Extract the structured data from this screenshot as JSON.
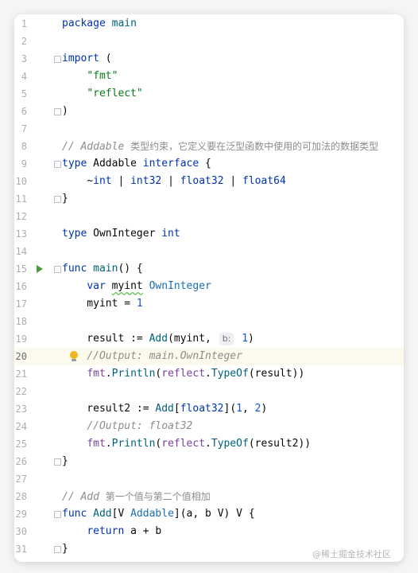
{
  "editor": {
    "run_line": 15,
    "highlighted_line": 20,
    "lines": [
      {
        "n": "1",
        "t": [
          [
            "kw",
            "package"
          ],
          [
            "t",
            " "
          ],
          [
            "fn",
            "main"
          ]
        ]
      },
      {
        "n": "2",
        "t": []
      },
      {
        "n": "3",
        "fold": true,
        "t": [
          [
            "kw",
            "import"
          ],
          [
            "t",
            " ("
          ]
        ]
      },
      {
        "n": "4",
        "t": [
          [
            "t",
            "    "
          ],
          [
            "str",
            "\"fmt\""
          ]
        ]
      },
      {
        "n": "5",
        "t": [
          [
            "t",
            "    "
          ],
          [
            "str",
            "\"reflect\""
          ]
        ]
      },
      {
        "n": "6",
        "fold": true,
        "t": [
          [
            "t",
            ")"
          ]
        ]
      },
      {
        "n": "7",
        "t": []
      },
      {
        "n": "8",
        "t": [
          [
            "cmt",
            "// Addable "
          ],
          [
            "cmt-cjk",
            "类型约束，它定义要在泛型函数中使用的可加法的数据类型"
          ]
        ]
      },
      {
        "n": "9",
        "fold": true,
        "t": [
          [
            "kw",
            "type"
          ],
          [
            "t",
            " Addable "
          ],
          [
            "kw",
            "interface"
          ],
          [
            "t",
            " {"
          ]
        ]
      },
      {
        "n": "10",
        "t": [
          [
            "t",
            "    ~"
          ],
          [
            "typename",
            "int"
          ],
          [
            "t",
            " | "
          ],
          [
            "typename",
            "int32"
          ],
          [
            "t",
            " | "
          ],
          [
            "typename",
            "float32"
          ],
          [
            "t",
            " | "
          ],
          [
            "typename",
            "float64"
          ]
        ]
      },
      {
        "n": "11",
        "fold": true,
        "t": [
          [
            "t",
            "}"
          ]
        ]
      },
      {
        "n": "12",
        "t": []
      },
      {
        "n": "13",
        "t": [
          [
            "kw",
            "type"
          ],
          [
            "t",
            " OwnInteger "
          ],
          [
            "typename",
            "int"
          ]
        ]
      },
      {
        "n": "14",
        "t": []
      },
      {
        "n": "15",
        "run": true,
        "fold": true,
        "t": [
          [
            "kw",
            "func"
          ],
          [
            "t",
            " "
          ],
          [
            "fn",
            "main"
          ],
          [
            "t",
            "() {"
          ]
        ]
      },
      {
        "n": "16",
        "t": [
          [
            "t",
            "    "
          ],
          [
            "kw",
            "var"
          ],
          [
            "t",
            " "
          ],
          [
            "sq",
            "myint"
          ],
          [
            "t",
            " "
          ],
          [
            "owntype",
            "OwnInteger"
          ]
        ]
      },
      {
        "n": "17",
        "t": [
          [
            "t",
            "    myint = "
          ],
          [
            "num",
            "1"
          ]
        ]
      },
      {
        "n": "18",
        "t": []
      },
      {
        "n": "19",
        "t": [
          [
            "t",
            "    result := "
          ],
          [
            "fn",
            "Add"
          ],
          [
            "t",
            "(myint, "
          ],
          [
            "hint",
            "b:"
          ],
          [
            "t",
            " "
          ],
          [
            "num",
            "1"
          ],
          [
            "t",
            ")"
          ]
        ]
      },
      {
        "n": "20",
        "bulb": true,
        "t": [
          [
            "t",
            "    "
          ],
          [
            "cmt",
            "//Output: main.OwnInteger"
          ]
        ]
      },
      {
        "n": "21",
        "t": [
          [
            "t",
            "    "
          ],
          [
            "pkgref",
            "fmt"
          ],
          [
            "t",
            "."
          ],
          [
            "fn",
            "Println"
          ],
          [
            "t",
            "("
          ],
          [
            "pkgref",
            "reflect"
          ],
          [
            "t",
            "."
          ],
          [
            "fn",
            "TypeOf"
          ],
          [
            "t",
            "(result))"
          ]
        ]
      },
      {
        "n": "22",
        "t": []
      },
      {
        "n": "23",
        "t": [
          [
            "t",
            "    result2 := "
          ],
          [
            "fn",
            "Add"
          ],
          [
            "t",
            "["
          ],
          [
            "typename",
            "float32"
          ],
          [
            "t",
            "]("
          ],
          [
            "num",
            "1"
          ],
          [
            "t",
            ", "
          ],
          [
            "num",
            "2"
          ],
          [
            "t",
            ")"
          ]
        ]
      },
      {
        "n": "24",
        "t": [
          [
            "t",
            "    "
          ],
          [
            "cmt",
            "//Output: float32"
          ]
        ]
      },
      {
        "n": "25",
        "t": [
          [
            "t",
            "    "
          ],
          [
            "pkgref",
            "fmt"
          ],
          [
            "t",
            "."
          ],
          [
            "fn",
            "Println"
          ],
          [
            "t",
            "("
          ],
          [
            "pkgref",
            "reflect"
          ],
          [
            "t",
            "."
          ],
          [
            "fn",
            "TypeOf"
          ],
          [
            "t",
            "(result2))"
          ]
        ]
      },
      {
        "n": "26",
        "fold": true,
        "t": [
          [
            "t",
            "}"
          ]
        ]
      },
      {
        "n": "27",
        "t": []
      },
      {
        "n": "28",
        "t": [
          [
            "cmt",
            "// Add "
          ],
          [
            "cmt-cjk",
            "第一个值与第二个值相加"
          ]
        ]
      },
      {
        "n": "29",
        "fold": true,
        "t": [
          [
            "kw",
            "func"
          ],
          [
            "t",
            " "
          ],
          [
            "fn",
            "Add"
          ],
          [
            "t",
            "[V "
          ],
          [
            "owntype",
            "Addable"
          ],
          [
            "t",
            "](a, b V) V {"
          ]
        ]
      },
      {
        "n": "30",
        "t": [
          [
            "t",
            "    "
          ],
          [
            "kw",
            "return"
          ],
          [
            "t",
            " a + b"
          ]
        ]
      },
      {
        "n": "31",
        "fold": true,
        "t": [
          [
            "t",
            "}"
          ]
        ]
      }
    ]
  },
  "watermark": "@稀土掘金技术社区",
  "colors": {
    "keyword": "#0033b3",
    "function": "#00627a",
    "string": "#067d17",
    "number": "#1750eb",
    "comment": "#8c8c8c",
    "highlight_line": "#fcfaed",
    "run_icon": "#4a9c3b",
    "bulb_icon": "#f0b722"
  },
  "icons": {
    "run": "run-triangle-icon",
    "bulb": "intention-bulb-icon",
    "fold": "fold-marker-icon"
  }
}
